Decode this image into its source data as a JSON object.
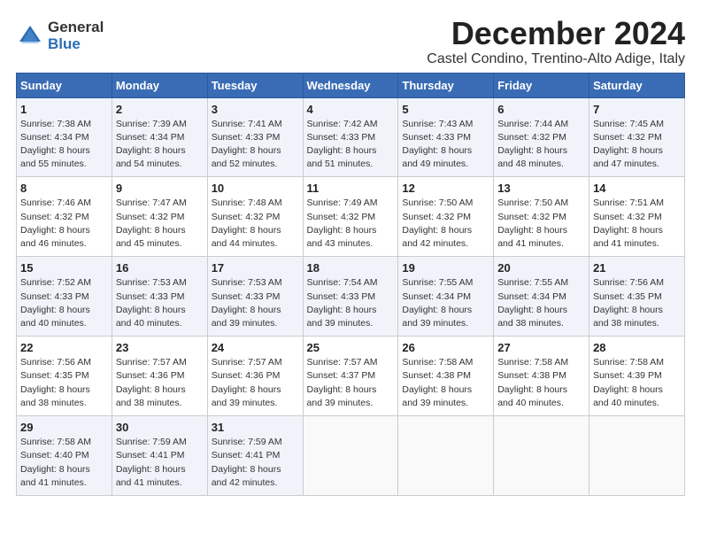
{
  "logo": {
    "general": "General",
    "blue": "Blue"
  },
  "title": "December 2024",
  "location": "Castel Condino, Trentino-Alto Adige, Italy",
  "days_header": [
    "Sunday",
    "Monday",
    "Tuesday",
    "Wednesday",
    "Thursday",
    "Friday",
    "Saturday"
  ],
  "weeks": [
    [
      {
        "day": "1",
        "sunrise": "7:38 AM",
        "sunset": "4:34 PM",
        "daylight": "8 hours and 55 minutes."
      },
      {
        "day": "2",
        "sunrise": "7:39 AM",
        "sunset": "4:34 PM",
        "daylight": "8 hours and 54 minutes."
      },
      {
        "day": "3",
        "sunrise": "7:41 AM",
        "sunset": "4:33 PM",
        "daylight": "8 hours and 52 minutes."
      },
      {
        "day": "4",
        "sunrise": "7:42 AM",
        "sunset": "4:33 PM",
        "daylight": "8 hours and 51 minutes."
      },
      {
        "day": "5",
        "sunrise": "7:43 AM",
        "sunset": "4:33 PM",
        "daylight": "8 hours and 49 minutes."
      },
      {
        "day": "6",
        "sunrise": "7:44 AM",
        "sunset": "4:32 PM",
        "daylight": "8 hours and 48 minutes."
      },
      {
        "day": "7",
        "sunrise": "7:45 AM",
        "sunset": "4:32 PM",
        "daylight": "8 hours and 47 minutes."
      }
    ],
    [
      {
        "day": "8",
        "sunrise": "7:46 AM",
        "sunset": "4:32 PM",
        "daylight": "8 hours and 46 minutes."
      },
      {
        "day": "9",
        "sunrise": "7:47 AM",
        "sunset": "4:32 PM",
        "daylight": "8 hours and 45 minutes."
      },
      {
        "day": "10",
        "sunrise": "7:48 AM",
        "sunset": "4:32 PM",
        "daylight": "8 hours and 44 minutes."
      },
      {
        "day": "11",
        "sunrise": "7:49 AM",
        "sunset": "4:32 PM",
        "daylight": "8 hours and 43 minutes."
      },
      {
        "day": "12",
        "sunrise": "7:50 AM",
        "sunset": "4:32 PM",
        "daylight": "8 hours and 42 minutes."
      },
      {
        "day": "13",
        "sunrise": "7:50 AM",
        "sunset": "4:32 PM",
        "daylight": "8 hours and 41 minutes."
      },
      {
        "day": "14",
        "sunrise": "7:51 AM",
        "sunset": "4:32 PM",
        "daylight": "8 hours and 41 minutes."
      }
    ],
    [
      {
        "day": "15",
        "sunrise": "7:52 AM",
        "sunset": "4:33 PM",
        "daylight": "8 hours and 40 minutes."
      },
      {
        "day": "16",
        "sunrise": "7:53 AM",
        "sunset": "4:33 PM",
        "daylight": "8 hours and 40 minutes."
      },
      {
        "day": "17",
        "sunrise": "7:53 AM",
        "sunset": "4:33 PM",
        "daylight": "8 hours and 39 minutes."
      },
      {
        "day": "18",
        "sunrise": "7:54 AM",
        "sunset": "4:33 PM",
        "daylight": "8 hours and 39 minutes."
      },
      {
        "day": "19",
        "sunrise": "7:55 AM",
        "sunset": "4:34 PM",
        "daylight": "8 hours and 39 minutes."
      },
      {
        "day": "20",
        "sunrise": "7:55 AM",
        "sunset": "4:34 PM",
        "daylight": "8 hours and 38 minutes."
      },
      {
        "day": "21",
        "sunrise": "7:56 AM",
        "sunset": "4:35 PM",
        "daylight": "8 hours and 38 minutes."
      }
    ],
    [
      {
        "day": "22",
        "sunrise": "7:56 AM",
        "sunset": "4:35 PM",
        "daylight": "8 hours and 38 minutes."
      },
      {
        "day": "23",
        "sunrise": "7:57 AM",
        "sunset": "4:36 PM",
        "daylight": "8 hours and 38 minutes."
      },
      {
        "day": "24",
        "sunrise": "7:57 AM",
        "sunset": "4:36 PM",
        "daylight": "8 hours and 39 minutes."
      },
      {
        "day": "25",
        "sunrise": "7:57 AM",
        "sunset": "4:37 PM",
        "daylight": "8 hours and 39 minutes."
      },
      {
        "day": "26",
        "sunrise": "7:58 AM",
        "sunset": "4:38 PM",
        "daylight": "8 hours and 39 minutes."
      },
      {
        "day": "27",
        "sunrise": "7:58 AM",
        "sunset": "4:38 PM",
        "daylight": "8 hours and 40 minutes."
      },
      {
        "day": "28",
        "sunrise": "7:58 AM",
        "sunset": "4:39 PM",
        "daylight": "8 hours and 40 minutes."
      }
    ],
    [
      {
        "day": "29",
        "sunrise": "7:58 AM",
        "sunset": "4:40 PM",
        "daylight": "8 hours and 41 minutes."
      },
      {
        "day": "30",
        "sunrise": "7:59 AM",
        "sunset": "4:41 PM",
        "daylight": "8 hours and 41 minutes."
      },
      {
        "day": "31",
        "sunrise": "7:59 AM",
        "sunset": "4:41 PM",
        "daylight": "8 hours and 42 minutes."
      },
      null,
      null,
      null,
      null
    ]
  ]
}
